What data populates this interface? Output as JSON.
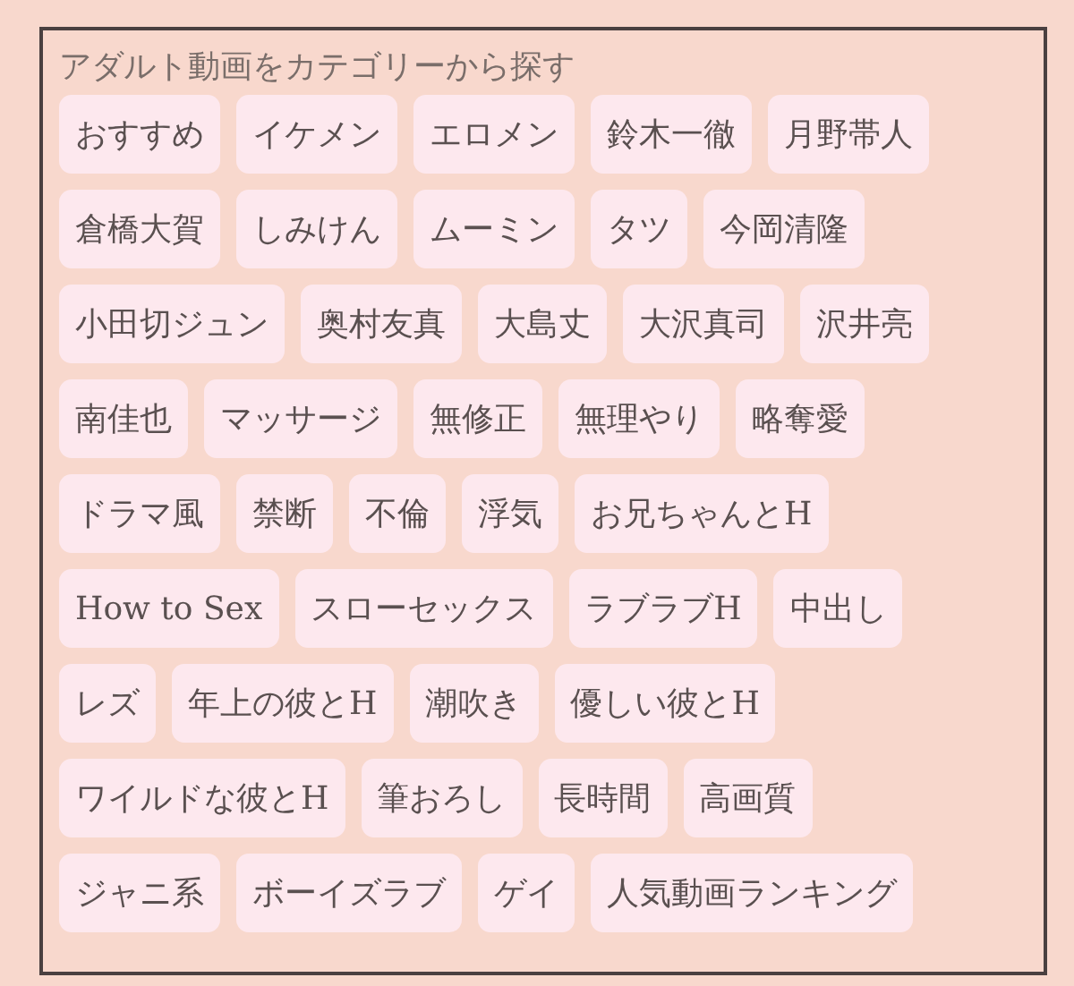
{
  "title": "アダルト動画をカテゴリーから探す",
  "tag_rows": [
    [
      "おすすめ",
      "イケメン",
      "エロメン",
      "鈴木一徹",
      "月野帯人"
    ],
    [
      "倉橋大賀",
      "しみけん",
      "ムーミン",
      "タツ",
      "今岡清隆"
    ],
    [
      "小田切ジュン",
      "奥村友真",
      "大島丈",
      "大沢真司",
      "沢井亮"
    ],
    [
      "南佳也",
      "マッサージ",
      "無修正",
      "無理やり",
      "略奪愛"
    ],
    [
      "ドラマ風",
      "禁断",
      "不倫",
      "浮気",
      "お兄ちゃんとH"
    ],
    [
      "How to Sex",
      "スローセックス",
      "ラブラブH",
      "中出し"
    ],
    [
      "レズ",
      "年上の彼とH",
      "潮吹き",
      "優しい彼とH"
    ],
    [
      "ワイルドな彼とH",
      "筆おろし",
      "長時間",
      "高画質"
    ],
    [
      "ジャニ系",
      "ボーイズラブ",
      "ゲイ",
      "人気動画ランキング"
    ]
  ]
}
